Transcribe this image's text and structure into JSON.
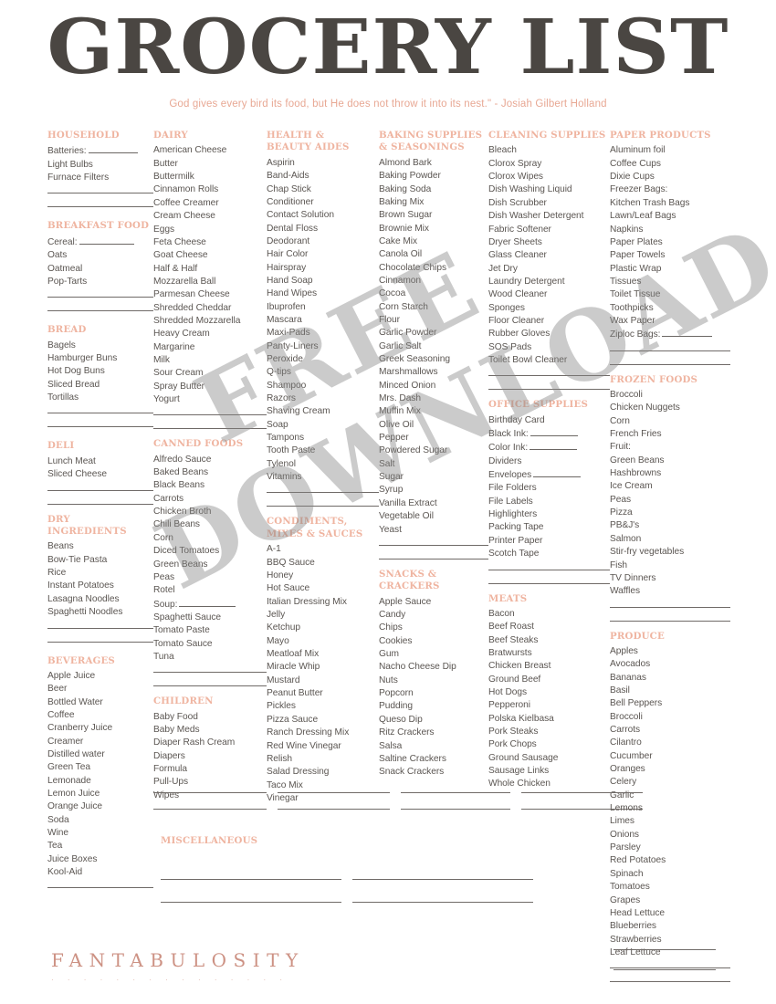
{
  "header": {
    "title": "GROCERY LIST",
    "quote": "God gives every bird its food, but He does not throw it into its nest.\" - Josiah Gilbert Holland"
  },
  "watermark": {
    "line1": "FREE",
    "line2": "DOWNLOAD"
  },
  "footer": {
    "brand": "FANTABULOSITY",
    "dots": "· · · · · · · · · · · · · · ·"
  },
  "colors": {
    "accent": "#efb4a0",
    "quote": "#e8a894",
    "title": "#4a4642",
    "item_text": "#5b5652",
    "rule": "#6f6a67",
    "brand": "#c9897a"
  },
  "sections": {
    "household": {
      "title": "HOUSEHOLD",
      "items": [
        "Batteries:",
        "Light Bulbs",
        "Furnace Filters"
      ],
      "fillin_first": true,
      "blank_lines": 2
    },
    "breakfast_food": {
      "title": "BREAKFAST FOOD",
      "items": [
        "Cereal:",
        "Oats",
        "Oatmeal",
        "Pop-Tarts"
      ],
      "fillin_first": true,
      "blank_lines": 2
    },
    "bread": {
      "title": "BREAD",
      "items": [
        "Bagels",
        "Hamburger Buns",
        "Hot Dog Buns",
        "Sliced Bread",
        "Tortillas"
      ],
      "blank_lines": 2
    },
    "deli": {
      "title": "DELI",
      "items": [
        "Lunch Meat",
        "Sliced Cheese"
      ],
      "blank_lines": 2
    },
    "dry_ingredients": {
      "title": "DRY INGREDIENTS",
      "items": [
        "Beans",
        "Bow-Tie Pasta",
        "Rice",
        "Instant Potatoes",
        "Lasagna Noodles",
        "Spaghetti Noodles"
      ],
      "blank_lines": 2
    },
    "beverages": {
      "title": "BEVERAGES",
      "items": [
        "Apple Juice",
        "Beer",
        "Bottled Water",
        "Coffee",
        "Cranberry Juice",
        "Creamer",
        "Distilled water",
        "Green Tea",
        "Lemonade",
        "Lemon Juice",
        "Orange Juice",
        "Soda",
        "Wine",
        "Tea",
        "Juice Boxes",
        "Kool-Aid"
      ],
      "blank_lines": 1
    },
    "dairy": {
      "title": "DAIRY",
      "items": [
        "American Cheese",
        "Butter",
        "Buttermilk",
        "Cinnamon Rolls",
        "Coffee Creamer",
        "Cream Cheese",
        "Eggs",
        "Feta Cheese",
        "Goat Cheese",
        "Half & Half",
        "Mozzarella Ball",
        "Parmesan Cheese",
        "Shredded Cheddar",
        "Shredded Mozzarella",
        "Heavy Cream",
        "Margarine",
        "Milk",
        "Sour Cream",
        "Spray Butter",
        "Yogurt"
      ],
      "blank_lines": 2
    },
    "canned_foods": {
      "title": "CANNED FOODS",
      "items": [
        "Alfredo Sauce",
        "Baked Beans",
        "Black Beans",
        "Carrots",
        "Chicken Broth",
        "Chili Beans",
        "Corn",
        "Diced Tomatoes",
        "Green Beans",
        "Peas",
        "Rotel",
        "Soup:",
        "Spaghetti Sauce",
        "Tomato Paste",
        "Tomato Sauce",
        "Tuna"
      ],
      "fillin_index": 11,
      "blank_lines": 2
    },
    "children": {
      "title": "CHILDREN",
      "items": [
        "Baby Food",
        "Baby Meds",
        "Diaper Rash Cream",
        "Diapers",
        "Formula",
        "Pull-Ups",
        "Wipes"
      ],
      "blank_lines": 2
    },
    "miscellaneous": {
      "title": "MISCELLANEOUS",
      "items": [],
      "blank_lines": 2
    },
    "health_beauty": {
      "title": "HEALTH &\nBEAUTY AIDES",
      "items": [
        "Aspirin",
        "Band-Aids",
        "Chap Stick",
        "Conditioner",
        "Contact Solution",
        "Dental Floss",
        "Deodorant",
        "Hair Color",
        "Hairspray",
        "Hand Soap",
        "Hand Wipes",
        "Ibuprofen",
        "Mascara",
        "Maxi-Pads",
        "Panty-Liners",
        "Peroxide",
        "Q-tips",
        "Shampoo",
        "Razors",
        "Shaving Cream",
        "Soap",
        "Tampons",
        "Tooth Paste",
        "Tylenol",
        "Vitamins"
      ],
      "blank_lines": 2
    },
    "condiments": {
      "title": "CONDIMENTS,\nMIXES & SAUCES",
      "items": [
        "A-1",
        "BBQ Sauce",
        "Honey",
        "Hot Sauce",
        "Italian Dressing Mix",
        "Jelly",
        "Ketchup",
        "Mayo",
        "Meatloaf Mix",
        "Miracle Whip",
        "Mustard",
        "Peanut Butter",
        "Pickles",
        "Pizza Sauce",
        "Ranch Dressing Mix",
        "Red Wine Vinegar",
        "Relish",
        "Salad Dressing",
        "Taco Mix",
        "Vinegar"
      ],
      "blank_lines": 2
    },
    "baking_supplies": {
      "title": "BAKING SUPPLIES\n& SEASONINGS",
      "items": [
        "Almond Bark",
        "Baking Powder",
        "Baking Soda",
        "Baking Mix",
        "Brown Sugar",
        "Brownie Mix",
        "Cake Mix",
        "Canola Oil",
        "Chocolate Chips",
        "Cinnamon",
        "Cocoa",
        "Corn Starch",
        "Flour",
        "Garlic Powder",
        "Garlic Salt",
        "Greek Seasoning",
        "Marshmallows",
        "Minced Onion",
        "Mrs. Dash",
        "Muffin Mix",
        "Olive Oil",
        "Pepper",
        "Powdered Sugar",
        "Salt",
        "Sugar",
        "Syrup",
        "Vanilla Extract",
        "Vegetable Oil",
        "Yeast"
      ],
      "blank_lines": 2
    },
    "snacks_crackers": {
      "title": "SNACKS &\nCRACKERS",
      "items": [
        "Apple Sauce",
        "Candy",
        "Chips",
        "Cookies",
        "Gum",
        "Nacho Cheese Dip",
        "Nuts",
        "Popcorn",
        "Pudding",
        "Queso Dip",
        "Ritz Crackers",
        "Salsa",
        "Saltine Crackers",
        "Snack Crackers"
      ],
      "blank_lines": 2
    },
    "cleaning_supplies": {
      "title": "CLEANING SUPPLIES",
      "items": [
        "Bleach",
        "Clorox Spray",
        "Clorox Wipes",
        "Dish Washing Liquid",
        "Dish Scrubber",
        "Dish Washer Detergent",
        "Fabric Softener",
        "Dryer Sheets",
        "Glass Cleaner",
        "Jet Dry",
        "Laundry Detergent",
        "Wood Cleaner",
        "Sponges",
        "Floor Cleaner",
        "Rubber Gloves",
        "SOS Pads",
        "Toilet Bowl Cleaner"
      ],
      "blank_lines": 2
    },
    "office_supplies": {
      "title": "OFFICE SUPPLIES",
      "items": [
        "Birthday Card",
        "Black Ink:",
        "Color Ink:",
        "Dividers",
        "Envelopes",
        "File Folders",
        "File Labels",
        "Highlighters",
        "Packing Tape",
        "Printer Paper",
        "Scotch Tape"
      ],
      "fillin_indices": [
        1,
        2,
        4
      ],
      "blank_lines": 2
    },
    "meats": {
      "title": "MEATS",
      "items": [
        "Bacon",
        "Beef Roast",
        "Beef Steaks",
        "Bratwursts",
        "Chicken Breast",
        "Ground Beef",
        "Hot Dogs",
        "Pepperoni",
        "Polska Kielbasa",
        "Pork Steaks",
        "Pork Chops",
        "Ground Sausage",
        "Sausage Links",
        "Whole Chicken"
      ],
      "blank_lines": 2
    },
    "paper_products": {
      "title": "PAPER PRODUCTS",
      "items": [
        "Aluminum foil",
        "Coffee Cups",
        "Dixie Cups",
        "Freezer Bags:",
        "Kitchen Trash Bags",
        "Lawn/Leaf Bags",
        "Napkins",
        "Paper Plates",
        "Paper Towels",
        "Plastic Wrap",
        "Tissues",
        "Toilet Tissue",
        "Toothpicks",
        "Wax Paper",
        "Ziploc Bags:"
      ],
      "fillin_indices": [
        14
      ],
      "blank_lines": 2
    },
    "frozen_foods": {
      "title": "FROZEN FOODS",
      "items": [
        "Broccoli",
        "Chicken Nuggets",
        "Corn",
        "French Fries",
        "Fruit:",
        "Green Beans",
        "Hashbrowns",
        "Ice Cream",
        "Peas",
        "Pizza",
        "PB&J's",
        "Salmon",
        "Stir-fry vegetables",
        "Fish",
        "TV Dinners",
        "Waffles"
      ],
      "blank_lines": 2
    },
    "produce": {
      "title": "PRODUCE",
      "items": [
        "Apples",
        "Avocados",
        "Bananas",
        "Basil",
        "Bell Peppers",
        "Broccoli",
        "Carrots",
        "Cilantro",
        "Cucumber",
        "Oranges",
        "Celery",
        "Garlic",
        "Lemons",
        "Limes",
        "Onions",
        "Parsley",
        "Red Potatoes",
        "Spinach",
        "Tomatoes",
        "Grapes",
        "Head Lettuce",
        "Blueberries",
        "Strawberries",
        "Leaf Lettuce"
      ],
      "blank_lines": 2
    }
  }
}
